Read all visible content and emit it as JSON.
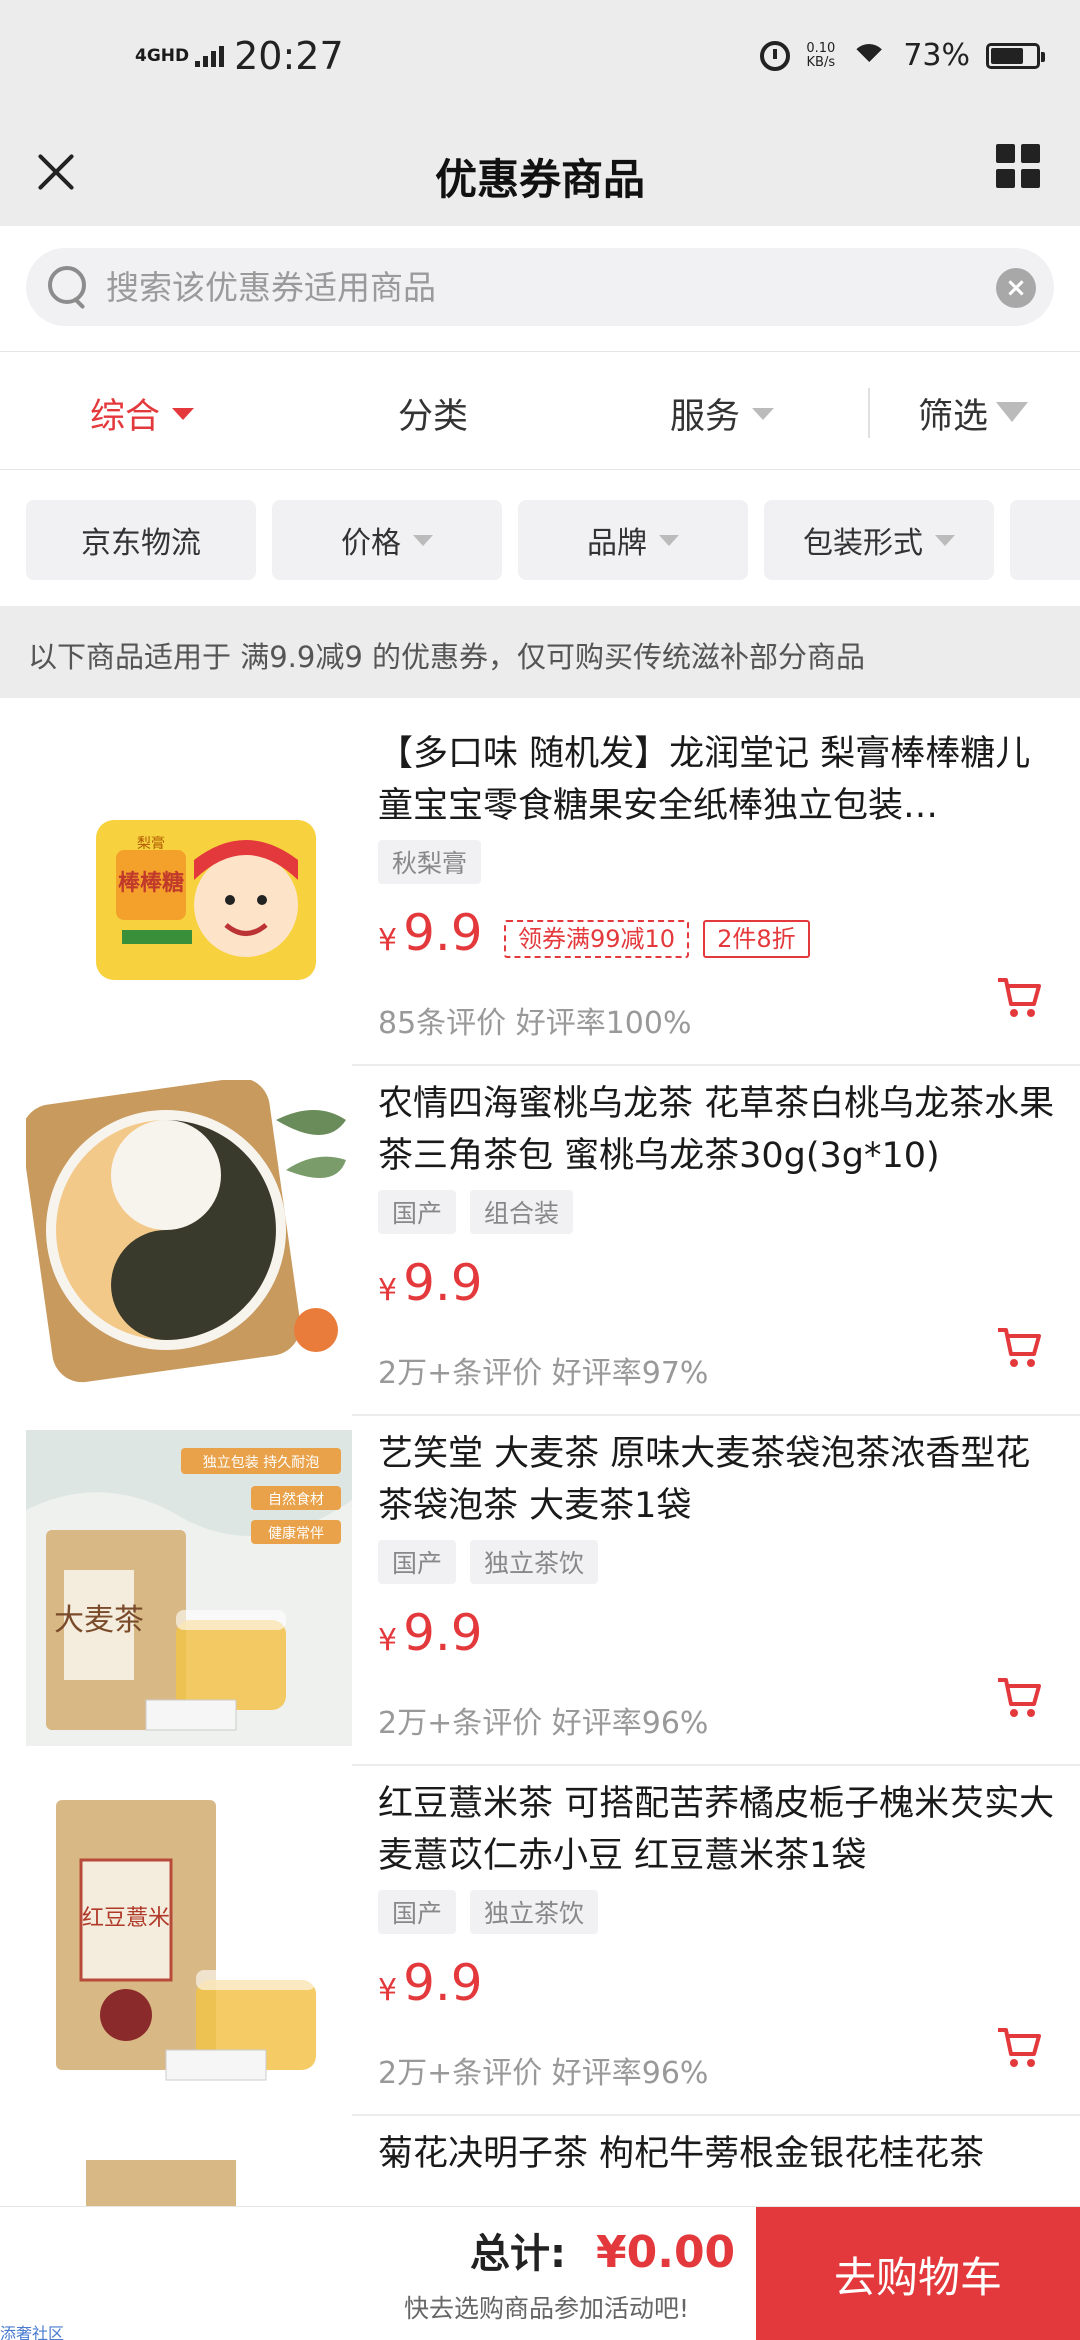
{
  "status_bar": {
    "network": "4GHD",
    "time": "20:27",
    "speed_value": "0.10",
    "speed_unit": "KB/s",
    "battery": "73%"
  },
  "nav": {
    "title": "优惠券商品"
  },
  "search": {
    "placeholder": "搜索该优惠券适用商品",
    "value": ""
  },
  "sort_tabs": [
    {
      "label": "综合",
      "active": true
    },
    {
      "label": "分类"
    },
    {
      "label": "服务"
    },
    {
      "label": "筛选"
    }
  ],
  "filter_chips": [
    "京东物流",
    "价格",
    "品牌",
    "包装形式"
  ],
  "notice": "以下商品适用于 满9.9减9 的优惠券，仅可购买传统滋补部分商品",
  "products": [
    {
      "title": "【多口味 随机发】龙润堂记 梨膏棒棒糖儿童宝宝零食糖果安全纸棒独立包装…",
      "tags": [
        "秋梨膏"
      ],
      "price": "9.9",
      "coupons": [
        "领券满99减10",
        "2件8折"
      ],
      "reviews": "85条评价 好评率100%",
      "image_text": {
        "line1": "梨膏",
        "line2": "棒棒糖"
      }
    },
    {
      "title": "农情四海蜜桃乌龙茶 花草茶白桃乌龙茶水果茶三角茶包 蜜桃乌龙茶30g(3g*10)",
      "tags": [
        "国产",
        "组合装"
      ],
      "price": "9.9",
      "coupons": [],
      "reviews": "2万+条评价 好评率97%"
    },
    {
      "title": "艺笑堂 大麦茶 原味大麦茶袋泡茶浓香型花茶袋泡茶 大麦茶1袋",
      "tags": [
        "国产",
        "独立茶饮"
      ],
      "price": "9.9",
      "coupons": [],
      "reviews": "2万+条评价 好评率96%",
      "image_text": {
        "badge1": "独立包装 持久耐泡",
        "badge2": "自然食材",
        "badge3": "健康常伴",
        "bag": "大麦茶"
      }
    },
    {
      "title": "红豆薏米茶 可搭配苦荞橘皮栀子槐米芡实大麦薏苡仁赤小豆 红豆薏米茶1袋",
      "tags": [
        "国产",
        "独立茶饮"
      ],
      "price": "9.9",
      "coupons": [],
      "reviews": "2万+条评价 好评率96%",
      "image_text": {
        "bag": "红豆薏米"
      }
    },
    {
      "title": "菊花决明子茶 枸杞牛蒡根金银花桂花茶",
      "tags": [],
      "price": "",
      "coupons": [],
      "reviews": ""
    }
  ],
  "currency_symbol": "¥",
  "bottom": {
    "total_label": "总计:",
    "total_value": "¥0.00",
    "hint": "快去选购商品参加活动吧!",
    "cart_button": "去购物车",
    "watermark": "添奢社区"
  },
  "colors": {
    "accent": "#e4393c",
    "background_gray": "#ececec",
    "chip_bg": "#f1f1f4"
  },
  "icons": [
    "close-icon",
    "grid-icon",
    "search-icon",
    "clear-icon",
    "filter-funnel-icon",
    "cart-icon",
    "alarm-icon",
    "wifi-icon",
    "battery-icon"
  ]
}
